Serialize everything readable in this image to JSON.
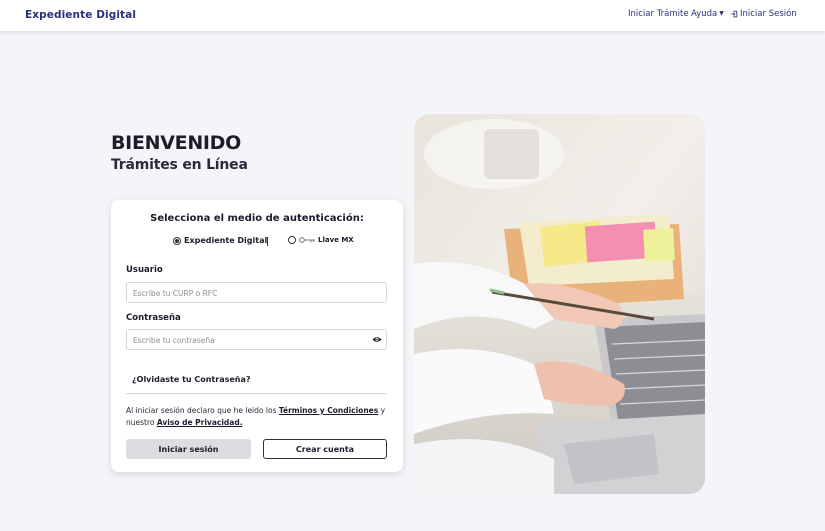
{
  "navbar": {
    "brand": "Expediente Digital",
    "links": {
      "iniciar_tramite": "Iniciar Trámite",
      "ayuda": "Ayuda",
      "iniciar_sesion": "Iniciar Sesión"
    }
  },
  "hero": {
    "title": "BIENVENIDO",
    "subtitle": "Trámites en Línea"
  },
  "login": {
    "heading": "Selecciona el medio de autenticación:",
    "auth_options": [
      {
        "label": "Expediente Digital",
        "selected": true
      },
      {
        "label": "Llave MX",
        "selected": false
      }
    ],
    "user_label": "Usuario",
    "user_placeholder": "Escribe tu CURP o RFC",
    "password_label": "Contraseña",
    "password_placeholder": "Escribe tu contraseña",
    "forgot": "¿Olvidaste tu Contraseña?",
    "terms_prefix": "Al iniciar sesión declaro que he leido los",
    "terms_link": "Términos y Condiciones",
    "terms_middle": "y nuestro",
    "privacy_link": "Aviso de Privacidad.",
    "login_button": "Iniciar sesión",
    "create_button": "Crear cuenta"
  },
  "colors": {
    "brand": "#2c2f7c",
    "background": "#f4f5f9",
    "login_button_bg": "#dcdde1"
  },
  "icons": {
    "login": "login-arrow-icon",
    "dropdown": "caret-down-icon",
    "password_toggle": "eye-icon"
  }
}
